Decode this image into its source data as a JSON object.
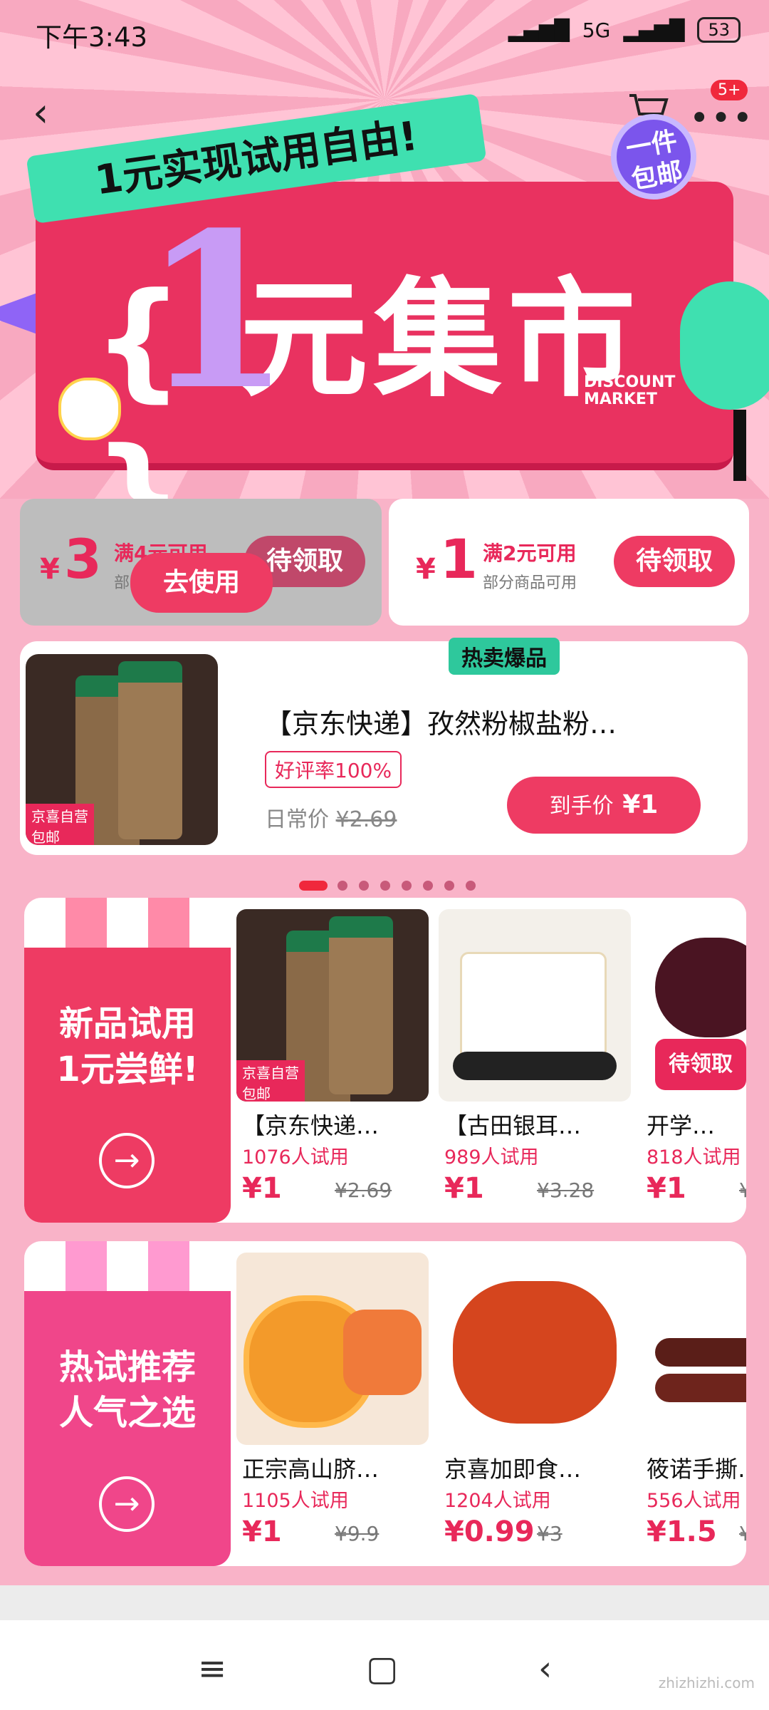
{
  "status_bar": {
    "time": "下午3:43",
    "network": "5G",
    "battery": "53"
  },
  "header": {
    "badge": "5+"
  },
  "banner": {
    "slogan": "1元实现试用自由!",
    "big_number": "1",
    "title": "{ 元集市 }",
    "subtitle_en_1": "DISCOUNT",
    "subtitle_en_2": "MARKET",
    "badge_1": "一件",
    "badge_2": "包邮"
  },
  "coupons": [
    {
      "currency": "¥",
      "amount": "3",
      "condition": "满4元可用",
      "scope": "部分商品可用",
      "action": "待领取",
      "overlay_action": "去使用"
    },
    {
      "currency": "¥",
      "amount": "1",
      "condition": "满2元可用",
      "scope": "部分商品可用",
      "action": "待领取"
    }
  ],
  "hot_product": {
    "tag": "热卖爆品",
    "title": "【京东快递】孜然粉椒盐粉…",
    "rating": "好评率100%",
    "orig_label": "日常价",
    "orig_price": "¥2.69",
    "price_btn_label": "到手价",
    "price": "¥1",
    "img_badge": "京喜自营",
    "img_badge2": "包邮"
  },
  "sections": [
    {
      "title_line1": "新品试用",
      "title_line2": "1元尝鲜!",
      "items": [
        {
          "title": "【京东快递…",
          "count": "1076人试用",
          "price": "¥1",
          "orig": "¥2.69"
        },
        {
          "title": "【古田银耳…",
          "count": "989人试用",
          "price": "¥1",
          "orig": "¥3.28"
        },
        {
          "title": "开学…",
          "count": "818人试用",
          "price": "¥1",
          "orig": "¥"
        }
      ],
      "float_badge": "待领取"
    },
    {
      "title_line1": "热试推荐",
      "title_line2": "人气之选",
      "items": [
        {
          "title": "正宗高山脐…",
          "count": "1105人试用",
          "price": "¥1",
          "orig": "¥9.9"
        },
        {
          "title": "京喜加即食…",
          "count": "1204人试用",
          "price": "¥0.99",
          "orig": "¥3"
        },
        {
          "title": "筱诺手撕…",
          "count": "556人试用",
          "price": "¥1.5",
          "orig": "¥"
        }
      ]
    }
  ],
  "watermark": "zhizhizhi.com",
  "colors": {
    "accent": "#ee3b63",
    "mint": "#3fe0b0",
    "purple": "#8f64f6"
  }
}
